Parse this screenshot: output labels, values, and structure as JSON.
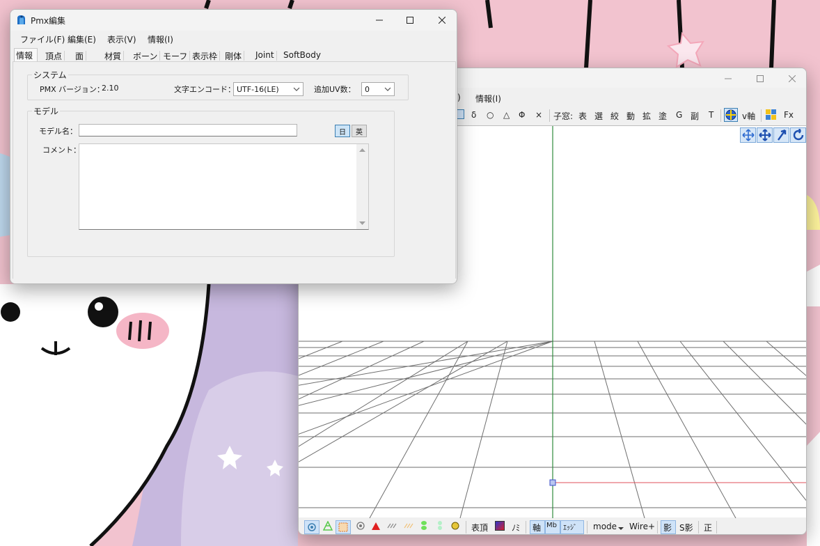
{
  "pmx_window": {
    "title": "Pmx編集",
    "caption": {
      "minimize": "—",
      "maximize": "☐",
      "close": "✕"
    },
    "menu": [
      "ファイル(F)",
      "編集(E)",
      "表示(V)",
      "情報(I)"
    ],
    "tabs": [
      "情報",
      "頂点",
      "面",
      "材質",
      "ボーン",
      "モーフ",
      "表示枠",
      "剛体",
      "Joint",
      "SoftBody"
    ],
    "active_tab": "情報",
    "system_group": {
      "legend": "システム",
      "pmx_version_label": "PMX バージョン：",
      "pmx_version_value": "2.10",
      "encoding_label": "文字エンコード：",
      "encoding_value": "UTF-16(LE)",
      "uv_label": "追加UV数：",
      "uv_value": "0"
    },
    "model_group": {
      "legend": "モデル",
      "name_label": "モデル名：",
      "name_value": "",
      "comment_label": "コメント：",
      "comment_value": "",
      "lang_jp": "日",
      "lang_en": "英"
    }
  },
  "viewer_window": {
    "caption": {
      "minimize": "—",
      "maximize": "☐",
      "close": "✕"
    },
    "menu_partial": "/)",
    "menu_info": "情報(I)",
    "toolbar": {
      "items": [
        "δ",
        "○",
        "△",
        "Φ",
        "×"
      ],
      "child_label": "子窓:",
      "child_items": [
        "表",
        "選",
        "絞",
        "動",
        "拡",
        "塗",
        "G",
        "副",
        "T"
      ],
      "vaxis": "v軸",
      "fx": "Fx"
    },
    "bottombar": {
      "labels": [
        "表頂",
        "ﾉﾐ",
        "軸",
        "Mb",
        "ｴｯｼﾞ",
        "mode",
        "Wire+",
        "影",
        "S影",
        "正"
      ]
    }
  },
  "colors": {
    "wallpaper_pink": "#f2c3cf",
    "wallpaper_purple": "#c7b8de",
    "axis_green": "#2e8b3d",
    "axis_red": "#e0505a",
    "accent_blue": "#3c7fb1"
  }
}
